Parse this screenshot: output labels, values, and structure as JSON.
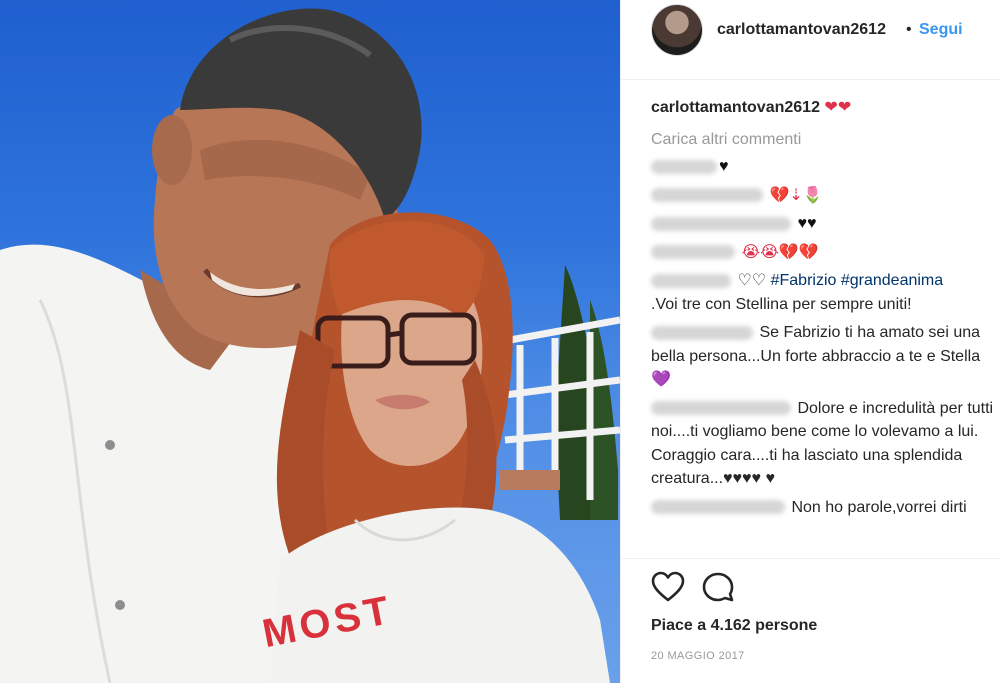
{
  "post": {
    "username": "carlottamantovan2612",
    "separator": "•",
    "follow_label": "Segui",
    "caption": "❤❤",
    "load_more": "Carica altri commenti",
    "comments": [
      {
        "text": "♥"
      },
      {
        "text": "💔⇣🌷"
      },
      {
        "text": "♥♥"
      },
      {
        "text": "😭😭💔💔"
      },
      {
        "pre": "♡♡ ",
        "tag1": "#Fabrizio",
        "tag2": "#grandeanima",
        "line2": ".Voi tre con Stellina per sempre uniti!"
      },
      {
        "text": "Se Fabrizio ti ha amato sei una bella persona...Un forte abbraccio a te e Stella",
        "emoji": "💜"
      },
      {
        "text": "Dolore e incredulità per tutti noi....ti vogliamo bene come lo volevamo a lui. Coraggio cara....ti ha lasciato una splendida creatura...♥♥♥♥ ♥"
      },
      {
        "text": "Non ho parole,vorrei dirti"
      }
    ],
    "likes": "Piace a 4.162 persone",
    "date": "20 MAGGIO 2017",
    "shirt_text": "MOST"
  },
  "colors": {
    "link": "#3897f0",
    "hashtag": "#003569",
    "heart": "#e0314b",
    "sky": "#2f74dc"
  },
  "icons": {
    "like": "heart-outline-icon",
    "comment": "speech-bubble-icon"
  }
}
